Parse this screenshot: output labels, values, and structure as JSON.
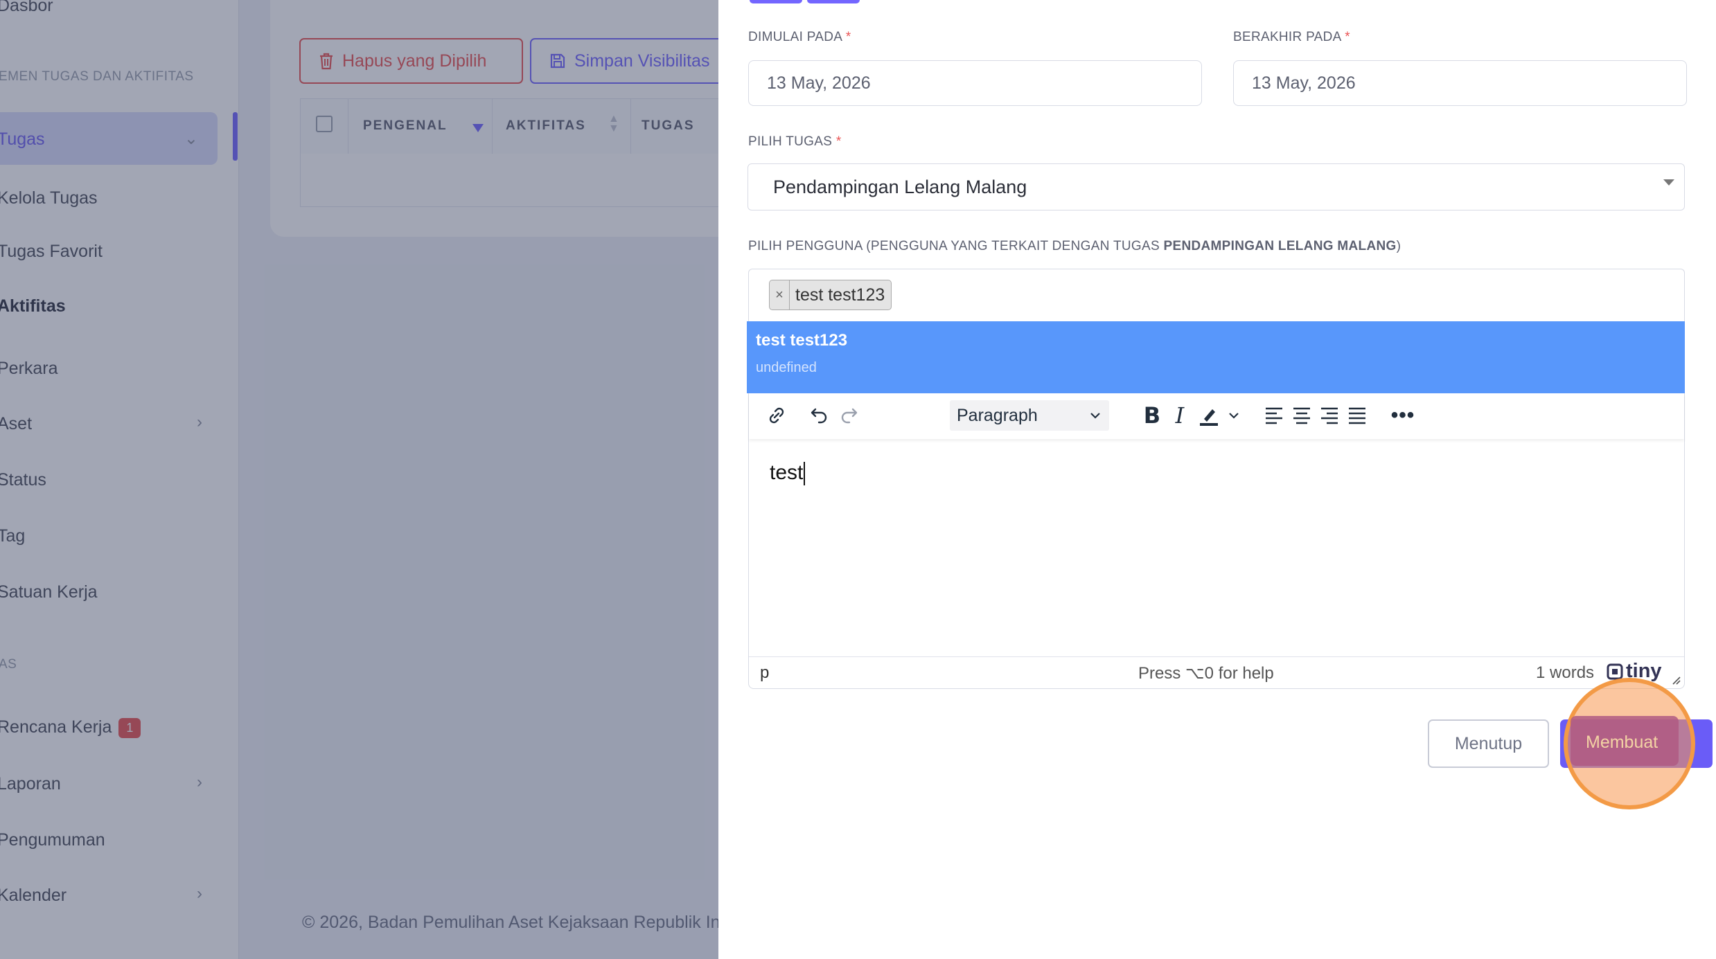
{
  "sidebar": {
    "top_item": "Dasbor",
    "section1": "EMEN TUGAS DAN AKTIFITAS",
    "tugas": "Tugas",
    "kelola_tugas": "Kelola Tugas",
    "tugas_favorit": "Tugas Favorit",
    "aktifitas": "Aktifitas",
    "perkara": "Perkara",
    "aset": "Aset",
    "status": "Status",
    "tag": "Tag",
    "satuan_kerja": "Satuan Kerja",
    "section2": "AS",
    "rencana_kerja": "Rencana Kerja",
    "rencana_kerja_badge": "1",
    "laporan": "Laporan",
    "pengumuman": "Pengumuman",
    "kalender": "Kalender"
  },
  "main": {
    "hapus_label": "Hapus yang Dipilih",
    "simpan_label": "Simpan Visibilitas",
    "columns": [
      "PENGENAL",
      "AKTIFITAS",
      "TUGAS"
    ],
    "footer": "© 2026, Badan Pemulihan Aset Kejaksaan Republik In"
  },
  "modal": {
    "start_label": "DIMULAI PADA",
    "end_label": "BERAKHIR PADA",
    "required_mark": "*",
    "start_value": "13 May, 2026",
    "end_value": "13 May, 2026",
    "task_label": "PILIH TUGAS",
    "task_value": "Pendampingan Lelang Malang",
    "user_label_prefix": "PILIH PENGGUNA (PENGGUNA YANG TERKAIT DENGAN TUGAS ",
    "user_label_bold": "PENDAMPINGAN LELANG MALANG",
    "user_label_suffix": ")",
    "selected_tag": "test test123",
    "tag_remove": "×",
    "dropdown_option_title": "test test123",
    "dropdown_option_sub": "undefined",
    "editor": {
      "format_select": "Paragraph",
      "content": "test",
      "status_path": "p",
      "status_help": "Press ⌥0 for help",
      "status_words": "1 words",
      "brand": "tiny"
    },
    "close_label": "Menutup",
    "create_label": "Membuat"
  },
  "colors": {
    "accent": "#7366ff",
    "danger": "#ea5455",
    "dropdown_highlight": "#5897fb",
    "click_indicator": "#f39a46"
  }
}
